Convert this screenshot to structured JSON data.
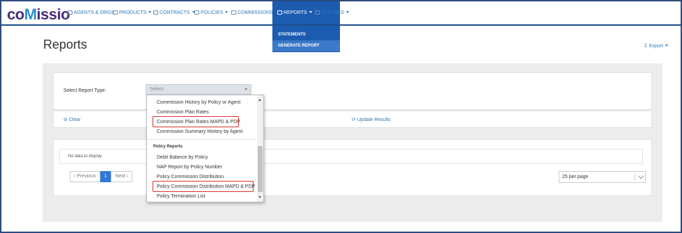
{
  "app": {
    "logo_text_a": "co",
    "logo_text_b": "issio",
    "logo_mark": "M"
  },
  "nav": {
    "items": [
      {
        "label": "AGENTS & ORGS",
        "caret": false
      },
      {
        "label": "PRODUCTS",
        "caret": true
      },
      {
        "label": "CONTRACTS",
        "caret": true
      },
      {
        "label": "POLICIES",
        "caret": true
      },
      {
        "label": "COMMISSIONS",
        "caret": true
      },
      {
        "label": "REPORTS",
        "caret": true,
        "active": true
      },
      {
        "label": "UTILITIES",
        "caret": true
      }
    ],
    "reports_menu": [
      "STATEMENTS",
      "GENERATE REPORT"
    ]
  },
  "page": {
    "title": "Reports",
    "export_label": "Export"
  },
  "criteria": {
    "select_label": "Select Report Type:",
    "select_placeholder": "Select"
  },
  "actions": {
    "clear_label": "Clear",
    "update_label": "Update Results"
  },
  "dropdown": {
    "options_group1": [
      "Commission History by Policy or Agent",
      "Commission Plan Rates",
      "Commission Plan Rates MAPD & PDP",
      "Commission Summary History by Agent"
    ],
    "group2_label": "Policy Reports",
    "options_group2": [
      "Debit Balance by Policy",
      "NAP Report by Policy Number",
      "Policy Commission Distribution",
      "Policy Commission Distribution MAPD & PDP",
      "Policy Termination List"
    ],
    "highlighted": [
      "Commission Plan Rates MAPD & PDP",
      "Policy Commission Distribution MAPD & PDP"
    ]
  },
  "results": {
    "no_data_text": "No data to display",
    "pager": {
      "previous_label": "Previous",
      "current_page": "1",
      "next_label": "Next"
    },
    "page_size": "25 per page"
  },
  "colors": {
    "nav_active": "#1b5bb0",
    "link": "#2d78b8",
    "highlight_box": "#d9302c",
    "brand_purple": "#4a2b7a"
  }
}
